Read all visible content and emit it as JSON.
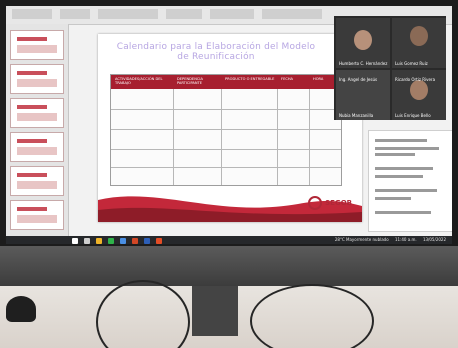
{
  "scene": "photo of a computer monitor showing a presentation with a video call",
  "slide": {
    "title_line1": "Calendario para la Elaboración del Modelo",
    "title_line2": "de Reunificación",
    "table_headers": [
      "ACTIVIDADES/ACCIÓN DEL TRABAJO",
      "DEPENDENCIA PARTICIPANTE",
      "PRODUCTO O ENTREGABLE",
      "FECHA",
      "HORA"
    ],
    "brand": "SEGOB"
  },
  "call": {
    "participants": [
      {
        "name": "Humberto C. Hernández"
      },
      {
        "name": "Luis Gomez Ruiz"
      },
      {
        "name": "Ing. Angel de Jesús"
      },
      {
        "name": "Ricardo Ortiz Rivera"
      },
      {
        "name": "Nubia Manzanilla"
      },
      {
        "name": "Luis Enrique Bello"
      }
    ]
  },
  "taskbar": {
    "weather": "28°C Mayormente nublado",
    "time": "11:40 a.m.",
    "date": "13/05/2022"
  },
  "colors": {
    "accent_red": "#a71f2f",
    "title_purple": "#b7a6e2",
    "taskbar": "#26282b"
  }
}
